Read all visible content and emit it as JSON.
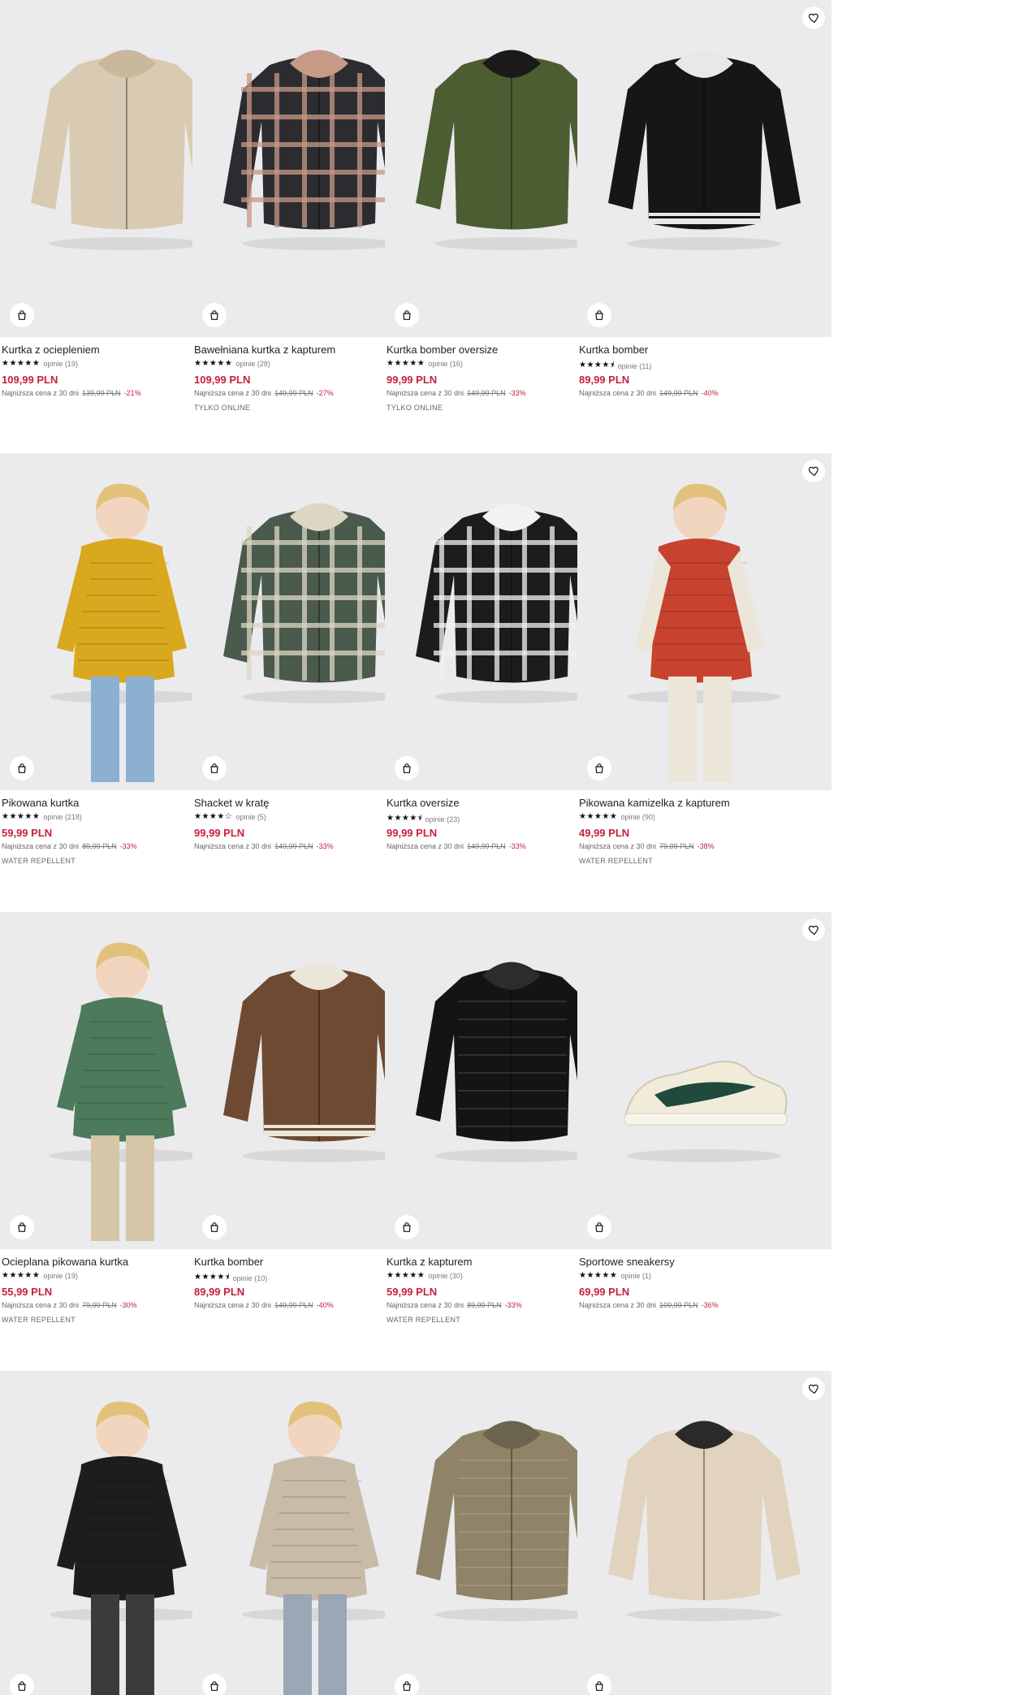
{
  "labels": {
    "lowest_price_prefix": "Najniższa cena z 30 dni"
  },
  "colors": {
    "price": "#c4213d",
    "photo_bg": "#ebebed"
  },
  "products": [
    {
      "title": "Kurtka z ociepleniem",
      "stars": "★★★★★",
      "reviews": "opinie (19)",
      "price": "109,99 PLN",
      "old_price": "139,99 PLN",
      "discount": "-21%",
      "tag": "",
      "icon": "sherpa-jacket-image",
      "garment": "#d9cbb3",
      "accent": "#c9b89c"
    },
    {
      "title": "Bawełniana kurtka z kapturem",
      "stars": "★★★★★",
      "reviews": "opinie (28)",
      "price": "109,99 PLN",
      "old_price": "149,99 PLN",
      "discount": "-27%",
      "tag": "TYLKO ONLINE",
      "icon": "plaid-jacket-image",
      "garment": "#2c2c30",
      "accent": "#c69a86"
    },
    {
      "title": "Kurtka bomber oversize",
      "stars": "★★★★★",
      "reviews": "opinie (16)",
      "price": "99,99 PLN",
      "old_price": "149,99 PLN",
      "discount": "-33%",
      "tag": "TYLKO ONLINE",
      "icon": "bomber-jacket-image",
      "garment": "#4d5d32",
      "accent": "#1a1a1a"
    },
    {
      "title": "Kurtka bomber",
      "stars": "★★★★⯨",
      "reviews": "opinie (11)",
      "price": "89,99 PLN",
      "old_price": "149,99 PLN",
      "discount": "-40%",
      "tag": "",
      "icon": "varsity-jacket-image",
      "garment": "#161616",
      "accent": "#e8e8e8"
    },
    {
      "title": "Pikowana kurtka",
      "stars": "★★★★★",
      "reviews": "opinie (218)",
      "price": "59,99 PLN",
      "old_price": "89,99 PLN",
      "discount": "-33%",
      "tag": "WATER REPELLENT",
      "icon": "puffer-jacket-image",
      "garment": "#d9a81e",
      "accent": "#8cb0d2"
    },
    {
      "title": "Shacket w kratę",
      "stars": "★★★★☆",
      "reviews": "opinie (5)",
      "price": "99,99 PLN",
      "old_price": "149,99 PLN",
      "discount": "-33%",
      "tag": "",
      "icon": "shacket-image",
      "garment": "#4a5a4c",
      "accent": "#dcd6c4"
    },
    {
      "title": "Kurtka oversize",
      "stars": "★★★★⯨",
      "reviews": "opinie (23)",
      "price": "99,99 PLN",
      "old_price": "149,99 PLN",
      "discount": "-33%",
      "tag": "",
      "icon": "check-jacket-image",
      "garment": "#1c1c1e",
      "accent": "#f2f2f2"
    },
    {
      "title": "Pikowana kamizelka z kapturem",
      "stars": "★★★★★",
      "reviews": "opinie (90)",
      "price": "49,99 PLN",
      "old_price": "79,99 PLN",
      "discount": "-38%",
      "tag": "WATER REPELLENT",
      "icon": "puffer-vest-image",
      "garment": "#c8432f",
      "accent": "#ece6d9"
    },
    {
      "title": "Ocieplana pikowana kurtka",
      "stars": "★★★★★",
      "reviews": "opinie (19)",
      "price": "55,99 PLN",
      "old_price": "79,99 PLN",
      "discount": "-30%",
      "tag": "WATER REPELLENT",
      "icon": "green-puffer-image",
      "garment": "#4c7a5a",
      "accent": "#d6c6a8"
    },
    {
      "title": "Kurtka bomber",
      "stars": "★★★★⯨",
      "reviews": "opinie (10)",
      "price": "89,99 PLN",
      "old_price": "149,99 PLN",
      "discount": "-40%",
      "tag": "",
      "icon": "champ-bomber-image",
      "garment": "#6e4a33",
      "accent": "#ece6da"
    },
    {
      "title": "Kurtka z kapturem",
      "stars": "★★★★★",
      "reviews": "opinie (30)",
      "price": "59,99 PLN",
      "old_price": "89,99 PLN",
      "discount": "-33%",
      "tag": "WATER REPELLENT",
      "icon": "black-hooded-jacket-image",
      "garment": "#141414",
      "accent": "#2c2c2c"
    },
    {
      "title": "Sportowe sneakersy",
      "stars": "★★★★★",
      "reviews": "opinie (1)",
      "price": "69,99 PLN",
      "old_price": "109,99 PLN",
      "discount": "-36%",
      "tag": "",
      "icon": "sneaker-image",
      "garment": "#f1ecd9",
      "accent": "#1f4a3c"
    },
    {
      "title": "",
      "stars": "",
      "reviews": "",
      "price": "",
      "old_price": "",
      "discount": "",
      "tag": "",
      "icon": "black-puffer-kid-image",
      "garment": "#1d1d1f",
      "accent": "#3b3b3b"
    },
    {
      "title": "",
      "stars": "",
      "reviews": "",
      "price": "",
      "old_price": "",
      "discount": "",
      "tag": "",
      "icon": "beige-vest-kid-image",
      "garment": "#c8bba8",
      "accent": "#9aa7b6"
    },
    {
      "title": "",
      "stars": "",
      "reviews": "",
      "price": "",
      "old_price": "",
      "discount": "",
      "tag": "",
      "icon": "khaki-puffer-image",
      "garment": "#8f8468",
      "accent": "#6d6450"
    },
    {
      "title": "",
      "stars": "",
      "reviews": "",
      "price": "",
      "old_price": "",
      "discount": "",
      "tag": "",
      "icon": "beige-hoodie-image",
      "garment": "#e1d3bd",
      "accent": "#2a2a2a"
    }
  ]
}
